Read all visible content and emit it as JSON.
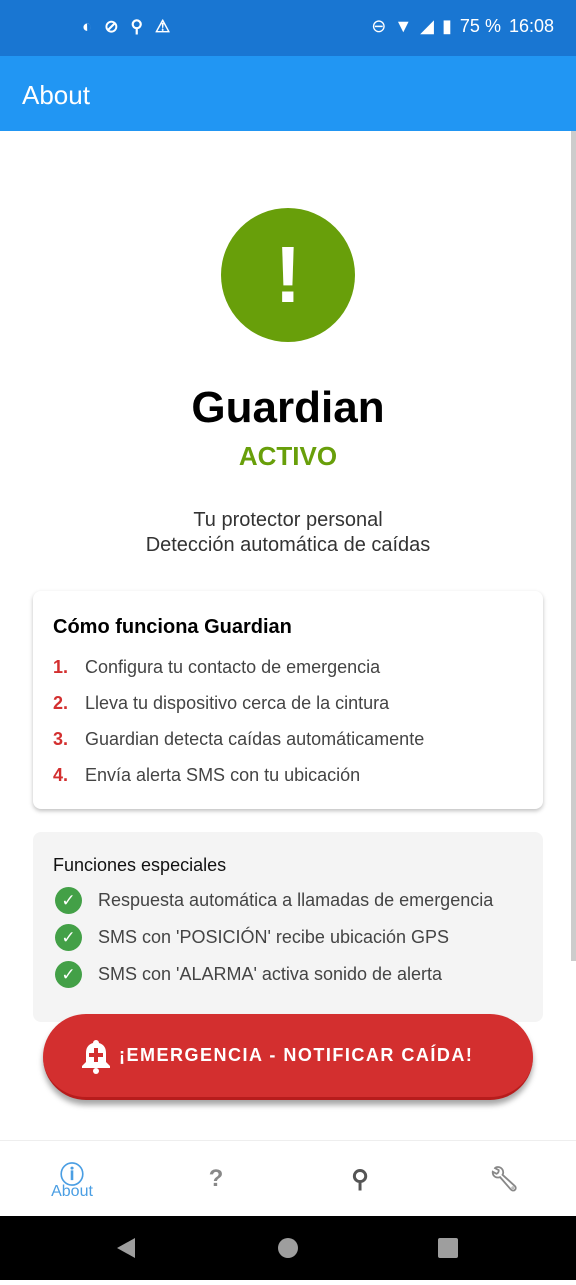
{
  "status": {
    "battery": "75 %",
    "time": "16:08"
  },
  "appbar": {
    "title": "About"
  },
  "hero": {
    "title": "Guardian",
    "state": "ACTIVO",
    "subtitle1": "Tu protector personal",
    "subtitle2": "Detección automática de caídas"
  },
  "how": {
    "title": "Cómo funciona Guardian",
    "steps": [
      {
        "n": "1.",
        "text": "Configura tu contacto de emergencia"
      },
      {
        "n": "2.",
        "text": "Lleva tu dispositivo cerca de la cintura"
      },
      {
        "n": "3.",
        "text": "Guardian detecta caídas automáticamente"
      },
      {
        "n": "4.",
        "text": "Envía alerta SMS con tu ubicación"
      }
    ]
  },
  "features": {
    "title": "Funciones especiales",
    "items": [
      "Respuesta automática a llamadas de emergencia",
      "SMS con 'POSICIÓN' recibe ubicación GPS",
      "SMS con 'ALARMA' activa sonido de alerta"
    ]
  },
  "emergency": {
    "label": "¡EMERGENCIA - NOTIFICAR CAÍDA!"
  },
  "nav": {
    "about": "About"
  },
  "colors": {
    "primary": "#2196f3",
    "active": "#689f0a",
    "danger": "#d32f2f"
  }
}
